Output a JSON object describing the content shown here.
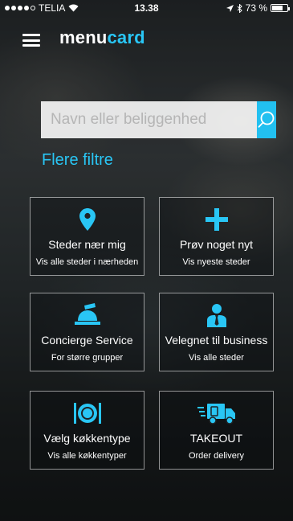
{
  "status_bar": {
    "carrier": "TELIA",
    "time": "13.38",
    "battery": "73 %",
    "battery_level": 0.73
  },
  "header": {
    "logo_part1": "menu",
    "logo_part2": "card"
  },
  "search": {
    "placeholder": "Navn eller beliggenhed"
  },
  "filters_link": "Flere filtre",
  "accent_color": "#29c6f5",
  "tiles": [
    {
      "icon": "location-pin-icon",
      "title": "Steder nær mig",
      "subtitle": "Vis alle steder i nærheden"
    },
    {
      "icon": "plus-icon",
      "title": "Prøv noget nyt",
      "subtitle": "Vis nyeste steder"
    },
    {
      "icon": "service-bell-icon",
      "title": "Concierge Service",
      "subtitle": "For større grupper"
    },
    {
      "icon": "businessman-icon",
      "title": "Velegnet til business",
      "subtitle": "Vis alle steder"
    },
    {
      "icon": "plate-cutlery-icon",
      "title": "Vælg køkkentype",
      "subtitle": "Vis alle køkkentyper"
    },
    {
      "icon": "delivery-truck-icon",
      "title": "TAKEOUT",
      "subtitle": "Order delivery"
    }
  ]
}
